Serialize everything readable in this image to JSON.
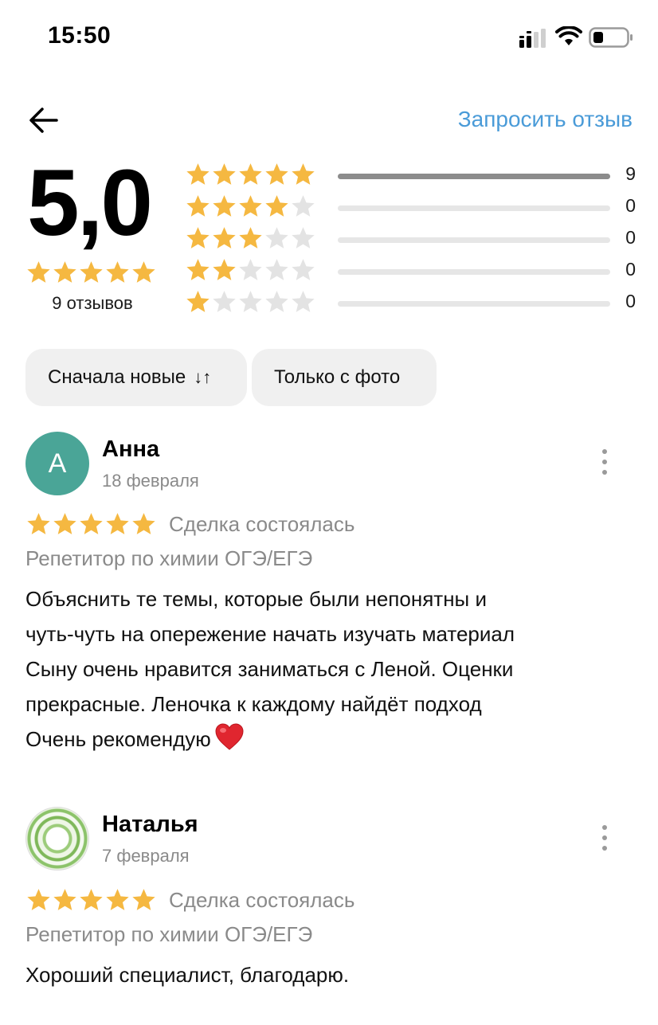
{
  "status_bar": {
    "time": "15:50",
    "icons": [
      "signal-icon",
      "wifi-icon",
      "battery-icon"
    ]
  },
  "header": {
    "back_icon": "arrow-left-icon",
    "request_review_label": "Запросить отзыв"
  },
  "summary": {
    "rating": "5,0",
    "rating_value": 5,
    "reviews_count_label": "9 отзывов",
    "distribution": [
      {
        "stars": 5,
        "count": "9",
        "fraction": 1.0
      },
      {
        "stars": 4,
        "count": "0",
        "fraction": 0
      },
      {
        "stars": 3,
        "count": "0",
        "fraction": 0
      },
      {
        "stars": 2,
        "count": "0",
        "fraction": 0
      },
      {
        "stars": 1,
        "count": "0",
        "fraction": 0
      }
    ]
  },
  "filters": {
    "sort_label": "Сначала новые",
    "sort_icon": "sort-arrows-icon",
    "photo_only_label": "Только с фото"
  },
  "reviews": [
    {
      "avatar_letter": "А",
      "name": "Анна",
      "date": "18 февраля",
      "rating": 5,
      "deal_status": "Сделка состоялась",
      "service": "Репетитор по химии ОГЭ/ЕГЭ",
      "text": "Объяснить те темы, которые были непонятны и\nчуть-чуть на опережение начать изучать материал\nСыну очень нравится заниматься с Леной. Оценки\nпрекрасные. Леночка к каждому найдёт подход\nОчень рекомендую"
    },
    {
      "avatar_letter": "",
      "name": "Наталья",
      "date": "7 февраля",
      "rating": 5,
      "deal_status": "Сделка состоялась",
      "service": "Репетитор по химии ОГЭ/ЕГЭ",
      "text": "Хороший специалист, благодарю."
    }
  ],
  "colors": {
    "accent_link": "#4a9bd8",
    "star_filled": "#f5b841",
    "star_empty": "#e3e3e3",
    "avatar_bg": "#4aa597",
    "bar_fill": "#8c8c8c",
    "bar_track": "#e6e6e6",
    "muted_text": "#8a8a8a",
    "chip_bg": "#f0f0f0"
  }
}
